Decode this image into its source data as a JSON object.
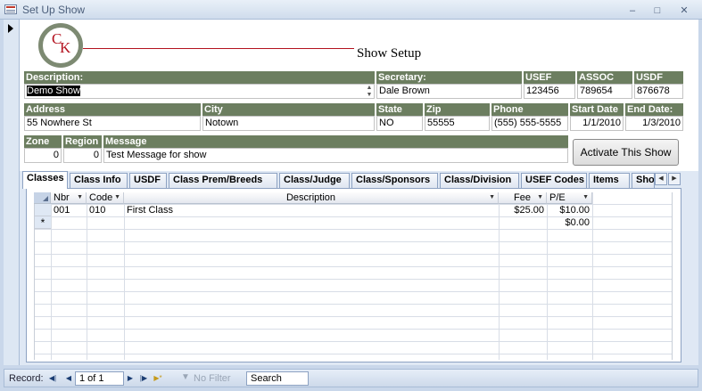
{
  "window": {
    "title": "Set Up Show"
  },
  "header": {
    "logo_c": "C",
    "logo_k": "K",
    "title": "Show Setup"
  },
  "fields": {
    "description_label": "Description:",
    "description_value": "Demo Show",
    "secretary_label": "Secretary:",
    "secretary_value": "Dale Brown",
    "usef_label": "USEF",
    "usef_value": "123456",
    "assoc_label": "ASSOC",
    "assoc_value": "789654",
    "usdf_label": "USDF",
    "usdf_value": "876678",
    "address_label": "Address",
    "address_value": "55 Nowhere St",
    "city_label": "City",
    "city_value": "Notown",
    "state_label": "State",
    "state_value": "NO",
    "zip_label": "Zip",
    "zip_value": "55555",
    "phone_label": "Phone",
    "phone_value": "(555) 555-5555",
    "start_date_label": "Start Date",
    "start_date_value": "1/1/2010",
    "end_date_label": "End Date:",
    "end_date_value": "1/3/2010",
    "zone_label": "Zone",
    "zone_value": "0",
    "region_label": "Region",
    "region_value": "0",
    "message_label": "Message",
    "message_value": "Test Message for show"
  },
  "activate_button": "Activate This Show",
  "tabs": [
    "Classes",
    "Class Info",
    "USDF",
    "Class Prem/Breeds",
    "Class/Judge",
    "Class/Sponsors",
    "Class/Division",
    "USEF Codes",
    "Items",
    "Sho"
  ],
  "grid": {
    "columns": [
      "Nbr",
      "Code",
      "Description",
      "Fee",
      "P/E"
    ],
    "rows": [
      {
        "nbr": "001",
        "code": "010",
        "description": "First Class",
        "fee": "$25.00",
        "pe": "$10.00"
      }
    ],
    "new_row": {
      "marker": "*",
      "pe": "$0.00"
    }
  },
  "statusbar": {
    "record_label": "Record:",
    "record_position": "1 of 1",
    "filter_label": "No Filter",
    "search_placeholder": "Search"
  },
  "icons": [
    "access-form-icon",
    "record-selector-arrow-icon",
    "minimize-icon",
    "maximize-icon",
    "close-icon",
    "dropdown-arrow-icon",
    "first-record-icon",
    "previous-record-icon",
    "next-record-icon",
    "last-record-icon",
    "new-record-icon",
    "filter-icon"
  ]
}
